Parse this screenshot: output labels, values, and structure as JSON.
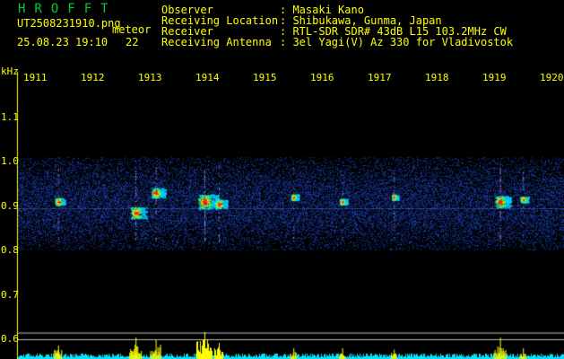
{
  "header": {
    "brand": "HROFFT",
    "filename": "UT2508231910.png",
    "type_label": "meteor",
    "datetime": "25.08.23 19:10",
    "page_num": "22"
  },
  "info": {
    "observer_label": "Observer",
    "observer_value": ": Masaki Kano",
    "location_label": "Receiving Location",
    "location_value": ": Shibukawa, Gunma, Japan",
    "receiver_label": "Receiver",
    "receiver_value": ": RTL-SDR SDR# 43dB L15 103.2MHz CW",
    "antenna_label": "Receiving Antenna",
    "antenna_value": ": 3el Yagi(V) Az 330 for Vladivostok"
  },
  "chart_data": {
    "type": "heatmap",
    "ylabel": "kHz",
    "x_ticks": [
      "1911",
      "1912",
      "1913",
      "1914",
      "1915",
      "1916",
      "1917",
      "1918",
      "1919",
      "1920"
    ],
    "y_ticks": [
      "1.1",
      "1.0",
      "0.9",
      "0.8",
      "0.7",
      "0.6"
    ],
    "ylim": [
      0.58,
      1.15
    ],
    "noise_band": [
      0.8,
      1.01
    ],
    "carrier_line": 0.895,
    "echoes": [
      {
        "time": 1911.45,
        "freq": 0.91,
        "strength": 0.5
      },
      {
        "time": 1912.8,
        "freq": 0.885,
        "strength": 0.8
      },
      {
        "time": 1913.15,
        "freq": 0.93,
        "strength": 0.7
      },
      {
        "time": 1914.0,
        "freq": 0.91,
        "strength": 1.0
      },
      {
        "time": 1914.25,
        "freq": 0.905,
        "strength": 0.6
      },
      {
        "time": 1915.55,
        "freq": 0.92,
        "strength": 0.4
      },
      {
        "time": 1916.4,
        "freq": 0.91,
        "strength": 0.4
      },
      {
        "time": 1917.3,
        "freq": 0.92,
        "strength": 0.35
      },
      {
        "time": 1919.15,
        "freq": 0.91,
        "strength": 0.8
      },
      {
        "time": 1919.55,
        "freq": 0.915,
        "strength": 0.4
      }
    ],
    "colors": {
      "text": "#ffff00",
      "brand": "#00cc33",
      "bars": "#ffff00",
      "noise": "#00e5ff"
    }
  }
}
